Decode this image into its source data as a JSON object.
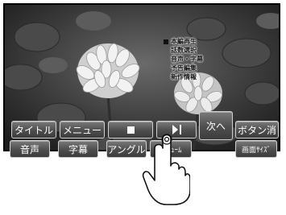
{
  "screen": {
    "background": "clover flowers",
    "menu_items": [
      "本編再生",
      "話数選択",
      "音声・字幕",
      "予告編集",
      "新作情報"
    ]
  },
  "controls": {
    "row1": {
      "title_label": "タイトル",
      "menu_label": "メニュー",
      "stop_icon": "stop-icon",
      "play_pause_icon": "play-pause-icon",
      "hide_label": "ボタン消"
    },
    "row2": {
      "audio_label": "音声",
      "subtitle_label": "字幕",
      "angle_label": "アングル",
      "resume_label": "ﾘｼﾞｭｰﾑ",
      "screen_size_label": "画面ｻｲｽﾞ"
    },
    "next_label": "次へ"
  },
  "colors": {
    "button_face": "#555555",
    "button_border": "#cfcfcf",
    "screen_border": "#000000"
  },
  "pointer": {
    "icon": "pointing-hand-icon"
  }
}
